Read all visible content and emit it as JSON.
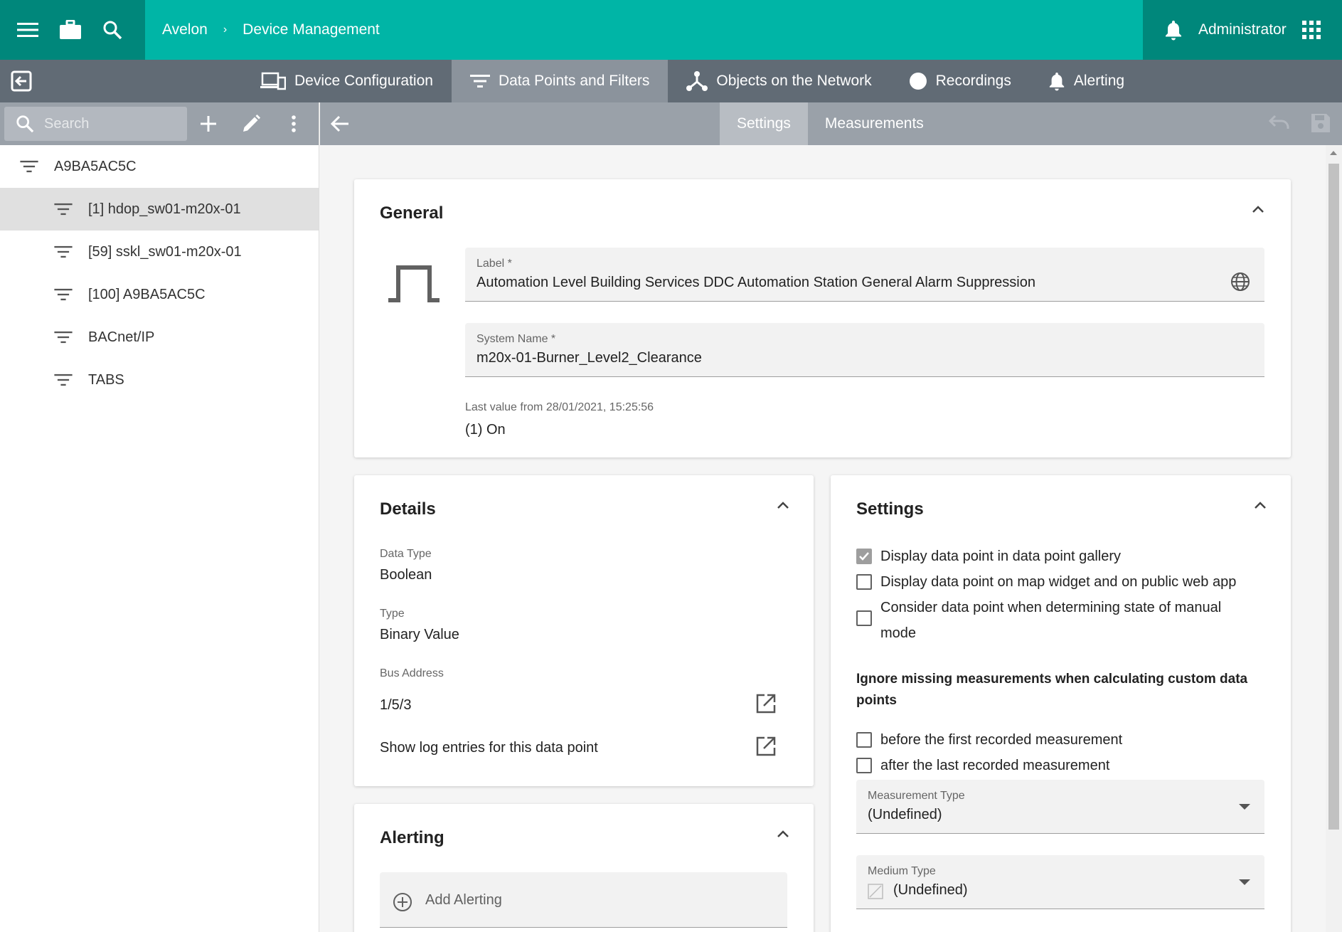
{
  "topbar": {
    "breadcrumb": [
      "Avelon",
      "Device Management"
    ],
    "breadcrumb_sep": "›",
    "user": "Administrator"
  },
  "tabs": [
    {
      "label": "Device Configuration",
      "icon": "devices-icon"
    },
    {
      "label": "Data Points and Filters",
      "icon": "filter-icon",
      "active": true
    },
    {
      "label": "Objects on the Network",
      "icon": "network-icon"
    },
    {
      "label": "Recordings",
      "icon": "record-icon"
    },
    {
      "label": "Alerting",
      "icon": "bell-icon"
    }
  ],
  "sidebar": {
    "search_placeholder": "Search",
    "tree": [
      {
        "label": "A9BA5AC5C",
        "level": 0
      },
      {
        "label": "[1] hdop_sw01-m20x-01",
        "level": 1,
        "selected": true
      },
      {
        "label": "[59] sskl_sw01-m20x-01",
        "level": 1
      },
      {
        "label": "[100] A9BA5AC5C",
        "level": 1
      },
      {
        "label": "BACnet/IP",
        "level": 1
      },
      {
        "label": "TABS",
        "level": 1
      }
    ]
  },
  "content_tabs": [
    {
      "label": "Settings",
      "active": true
    },
    {
      "label": "Measurements"
    }
  ],
  "general": {
    "title": "General",
    "label_label": "Label *",
    "label_value": "Automation Level Building Services DDC Automation Station General Alarm Suppression",
    "system_name_label": "System Name *",
    "system_name_value": "m20x-01-Burner_Level2_Clearance",
    "last_value_label": "Last value from 28/01/2021, 15:25:56",
    "last_value": "(1) On"
  },
  "details": {
    "title": "Details",
    "data_type_label": "Data Type",
    "data_type": "Boolean",
    "type_label": "Type",
    "type": "Binary Value",
    "bus_address_label": "Bus Address",
    "bus_address": "1/5/3",
    "log_entries": "Show log entries for this data point"
  },
  "alerting": {
    "title": "Alerting",
    "add_label": "Add Alerting"
  },
  "settings": {
    "title": "Settings",
    "checkboxes": [
      {
        "label": "Display data point in data point gallery",
        "checked": true
      },
      {
        "label": "Display data point on map widget and on public web app",
        "checked": false
      },
      {
        "label": "Consider data point when determining state of manual mode",
        "checked": false
      }
    ],
    "ignore_heading": "Ignore missing measurements when calculating custom data points",
    "ignore_options": [
      {
        "label": "before the first recorded measurement",
        "checked": false
      },
      {
        "label": "after the last recorded measurement",
        "checked": false
      }
    ],
    "measurement_type_label": "Measurement Type",
    "measurement_type": "(Undefined)",
    "medium_type_label": "Medium Type",
    "medium_type": "(Undefined)"
  },
  "colors": {
    "brand": "#00b5a6",
    "brand_dark": "#00877b",
    "tabbar": "#616b75",
    "toolbar": "#9aa1a9"
  }
}
